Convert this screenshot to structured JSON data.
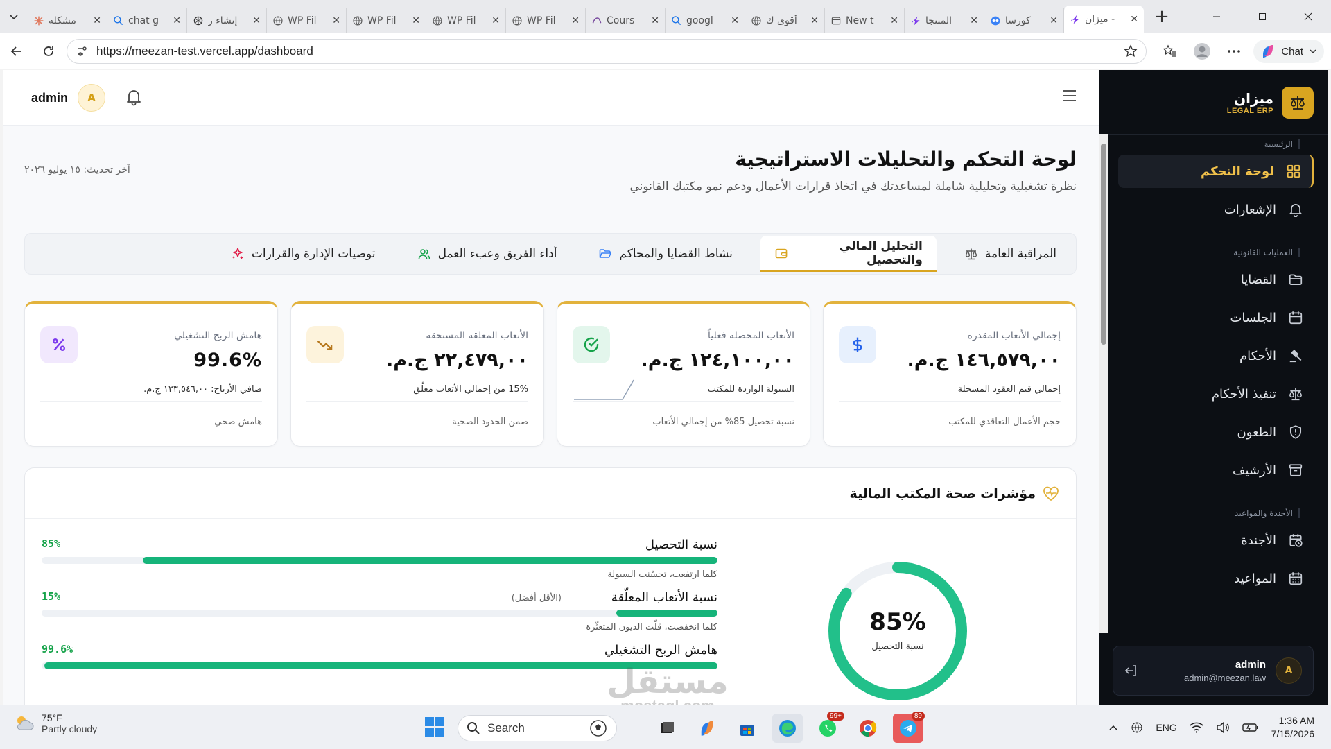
{
  "browser": {
    "tabs": [
      {
        "title": "مشكلة",
        "icon": "asterisk-icon",
        "color": "#e07a5f"
      },
      {
        "title": "chat g",
        "icon": "search-icon",
        "color": "#1a73e8"
      },
      {
        "title": "إنشاء ر",
        "icon": "openai-icon",
        "color": "#333333"
      },
      {
        "title": "WP Fil",
        "icon": "globe-icon",
        "color": "#555555"
      },
      {
        "title": "WP Fil",
        "icon": "globe-icon",
        "color": "#555555"
      },
      {
        "title": "WP Fil",
        "icon": "globe-icon",
        "color": "#555555"
      },
      {
        "title": "WP Fil",
        "icon": "globe-icon",
        "color": "#555555"
      },
      {
        "title": "Cours",
        "icon": "course-icon",
        "color": "#7b4fa0"
      },
      {
        "title": "googl",
        "icon": "search-icon",
        "color": "#1a73e8"
      },
      {
        "title": "أقوى ك",
        "icon": "globe-icon",
        "color": "#555555"
      },
      {
        "title": "New t",
        "icon": "newtab-icon",
        "color": "#555555"
      },
      {
        "title": "المنتجا",
        "icon": "bolt-icon",
        "color": "#7c3aed"
      },
      {
        "title": "كورسا",
        "icon": "copilot-icon",
        "color": "#3b82f6"
      },
      {
        "title": "ميزان -",
        "icon": "bolt-icon",
        "color": "#7c3aed",
        "active": true
      }
    ],
    "url": "https://meezan-test.vercel.app/dashboard",
    "chat_label": "Chat"
  },
  "topbar": {
    "user_name": "admin",
    "avatar_letter": "A"
  },
  "sidebar": {
    "brand_name": "ميزان",
    "brand_sub": "LEGAL ERP",
    "sections": [
      {
        "label": "الرئيسية",
        "items": [
          {
            "label": "لوحة التحكم",
            "icon": "dashboard-grid-icon",
            "active": true
          },
          {
            "label": "الإشعارات",
            "icon": "bell-icon"
          }
        ]
      },
      {
        "label": "العمليات القانونية",
        "items": [
          {
            "label": "القضايا",
            "icon": "folder-icon"
          },
          {
            "label": "الجلسات",
            "icon": "calendar-icon"
          },
          {
            "label": "الأحكام",
            "icon": "gavel-icon"
          },
          {
            "label": "تنفيذ الأحكام",
            "icon": "scales-icon"
          },
          {
            "label": "الطعون",
            "icon": "shield-alert-icon"
          },
          {
            "label": "الأرشيف",
            "icon": "archive-icon"
          }
        ]
      },
      {
        "label": "الأجندة والمواعيد",
        "items": [
          {
            "label": "الأجندة",
            "icon": "calendar-clock-icon"
          },
          {
            "label": "المواعيد",
            "icon": "calendar-grid-icon"
          }
        ]
      }
    ],
    "user": {
      "name": "admin",
      "email": "admin@meezan.law",
      "avatar_letter": "A"
    }
  },
  "page": {
    "title": "لوحة التحكم والتحليلات الاستراتيجية",
    "subtitle": "نظرة تشغيلية وتحليلية شاملة لمساعدتك في اتخاذ قرارات الأعمال ودعم نمو مكتبك القانوني",
    "last_updated": "آخر تحديث: ١٥ يوليو ٢٠٢٦"
  },
  "tabs": [
    {
      "label": "المراقبة العامة",
      "icon": "scales-icon"
    },
    {
      "label": "التحليل المالي والتحصيل",
      "icon": "wallet-icon",
      "active": true
    },
    {
      "label": "نشاط القضايا والمحاكم",
      "icon": "folder-open-icon"
    },
    {
      "label": "أداء الفريق وعبء العمل",
      "icon": "users-icon"
    },
    {
      "label": "توصيات الإدارة والقرارات",
      "icon": "sparkle-icon"
    }
  ],
  "kpis": [
    {
      "label": "إجمالي الأتعاب المقدرة",
      "value": "١٤٦,٥٧٩,٠٠ ج.م.",
      "sub": "إجمالي قيم العقود المسجلة",
      "foot": "حجم الأعمال التعاقدي للمكتب",
      "icon": "dollar-icon",
      "icon_bg": "#e7f0fd",
      "icon_color": "#2563eb"
    },
    {
      "label": "الأتعاب المحصلة فعلياً",
      "value": "١٢٤,١٠٠,٠٠ ج.م.",
      "sub": "السيولة الواردة للمكتب",
      "foot": "نسبة تحصيل 85% من إجمالي الأتعاب",
      "icon": "check-circle-icon",
      "icon_bg": "#e3f6ec",
      "icon_color": "#16a34a"
    },
    {
      "label": "الأتعاب المعلقة المستحقة",
      "value": "٢٢,٤٧٩,٠٠ ج.م.",
      "sub": "15% من إجمالي الأتعاب معلّق",
      "foot": "ضمن الحدود الصحية",
      "icon": "trend-down-icon",
      "icon_bg": "#fdf3dc",
      "icon_color": "#b7791f"
    },
    {
      "label": "هامش الربح التشغيلي",
      "value": "99.6%",
      "sub": "صافي الأرباح: ١٣٣,٥٤٦,٠٠ ج.م.",
      "foot": "هامش صحي",
      "icon": "percent-icon",
      "icon_bg": "#f1e8fd",
      "icon_color": "#7c3aed"
    }
  ],
  "health": {
    "title": "مؤشرات صحة المكتب المالية",
    "gauge_value": 85,
    "gauge_text": "85%",
    "gauge_label": "نسبة التحصيل",
    "metrics": [
      {
        "name": "نسبة التحصيل",
        "value_text": "85%",
        "fraction": 0.85,
        "desc": "كلما ارتفعت، تحسّنت السيولة",
        "hint": ""
      },
      {
        "name": "نسبة الأتعاب المعلّقة",
        "value_text": "15%",
        "fraction": 0.15,
        "desc": "كلما انخفضت، قلّت الديون المتعثّرة",
        "hint": "(الأقل أفضل)"
      },
      {
        "name": "هامش الربح التشغيلي",
        "value_text": "99.6%",
        "fraction": 0.996,
        "desc": "",
        "hint": ""
      }
    ]
  },
  "taskbar": {
    "temp": "75°F",
    "condition": "Partly cloudy",
    "search_placeholder": "Search",
    "lang": "ENG",
    "time": "1:36 AM",
    "date": "7/15/2026",
    "whatsapp_badge": "99+",
    "telegram_badge": "89"
  },
  "watermark": {
    "line1": "مستقل",
    "line2": "mostaql.com"
  }
}
